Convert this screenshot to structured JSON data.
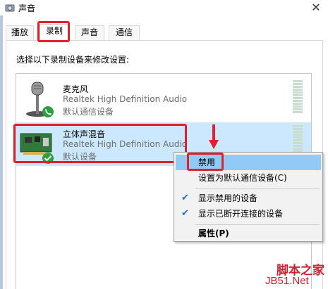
{
  "window": {
    "title": "声音",
    "close_glyph": "✕"
  },
  "tabs": [
    {
      "label": "播放"
    },
    {
      "label": "录制"
    },
    {
      "label": "声音"
    },
    {
      "label": "通信"
    }
  ],
  "instruction": "选择以下录制设备来修改设置:",
  "devices": [
    {
      "name": "麦克风",
      "driver": "Realtek High Definition Audio",
      "status": "默认通信设备",
      "icon": "microphone-icon",
      "badge": "phone-badge-icon"
    },
    {
      "name": "立体声混音",
      "driver": "Realtek High Definition Audio",
      "status": "默认设备",
      "icon": "sound-card-icon",
      "badge": "check-badge-icon"
    }
  ],
  "context_menu": {
    "items": [
      {
        "label": "禁用",
        "checked": false
      },
      {
        "label": "设置为默认通信设备(C)",
        "checked": false
      },
      {
        "label": "显示禁用的设备",
        "checked": true
      },
      {
        "label": "显示已断开连接的设备",
        "checked": true
      },
      {
        "label": "属性(P)",
        "checked": false
      }
    ]
  },
  "watermark": {
    "top": "脚本之家",
    "bottom": "JB51.Net"
  },
  "colors": {
    "highlight_red": "#e0202a",
    "selection": "#cce8ff",
    "menu_hover": "#91c9f7"
  }
}
